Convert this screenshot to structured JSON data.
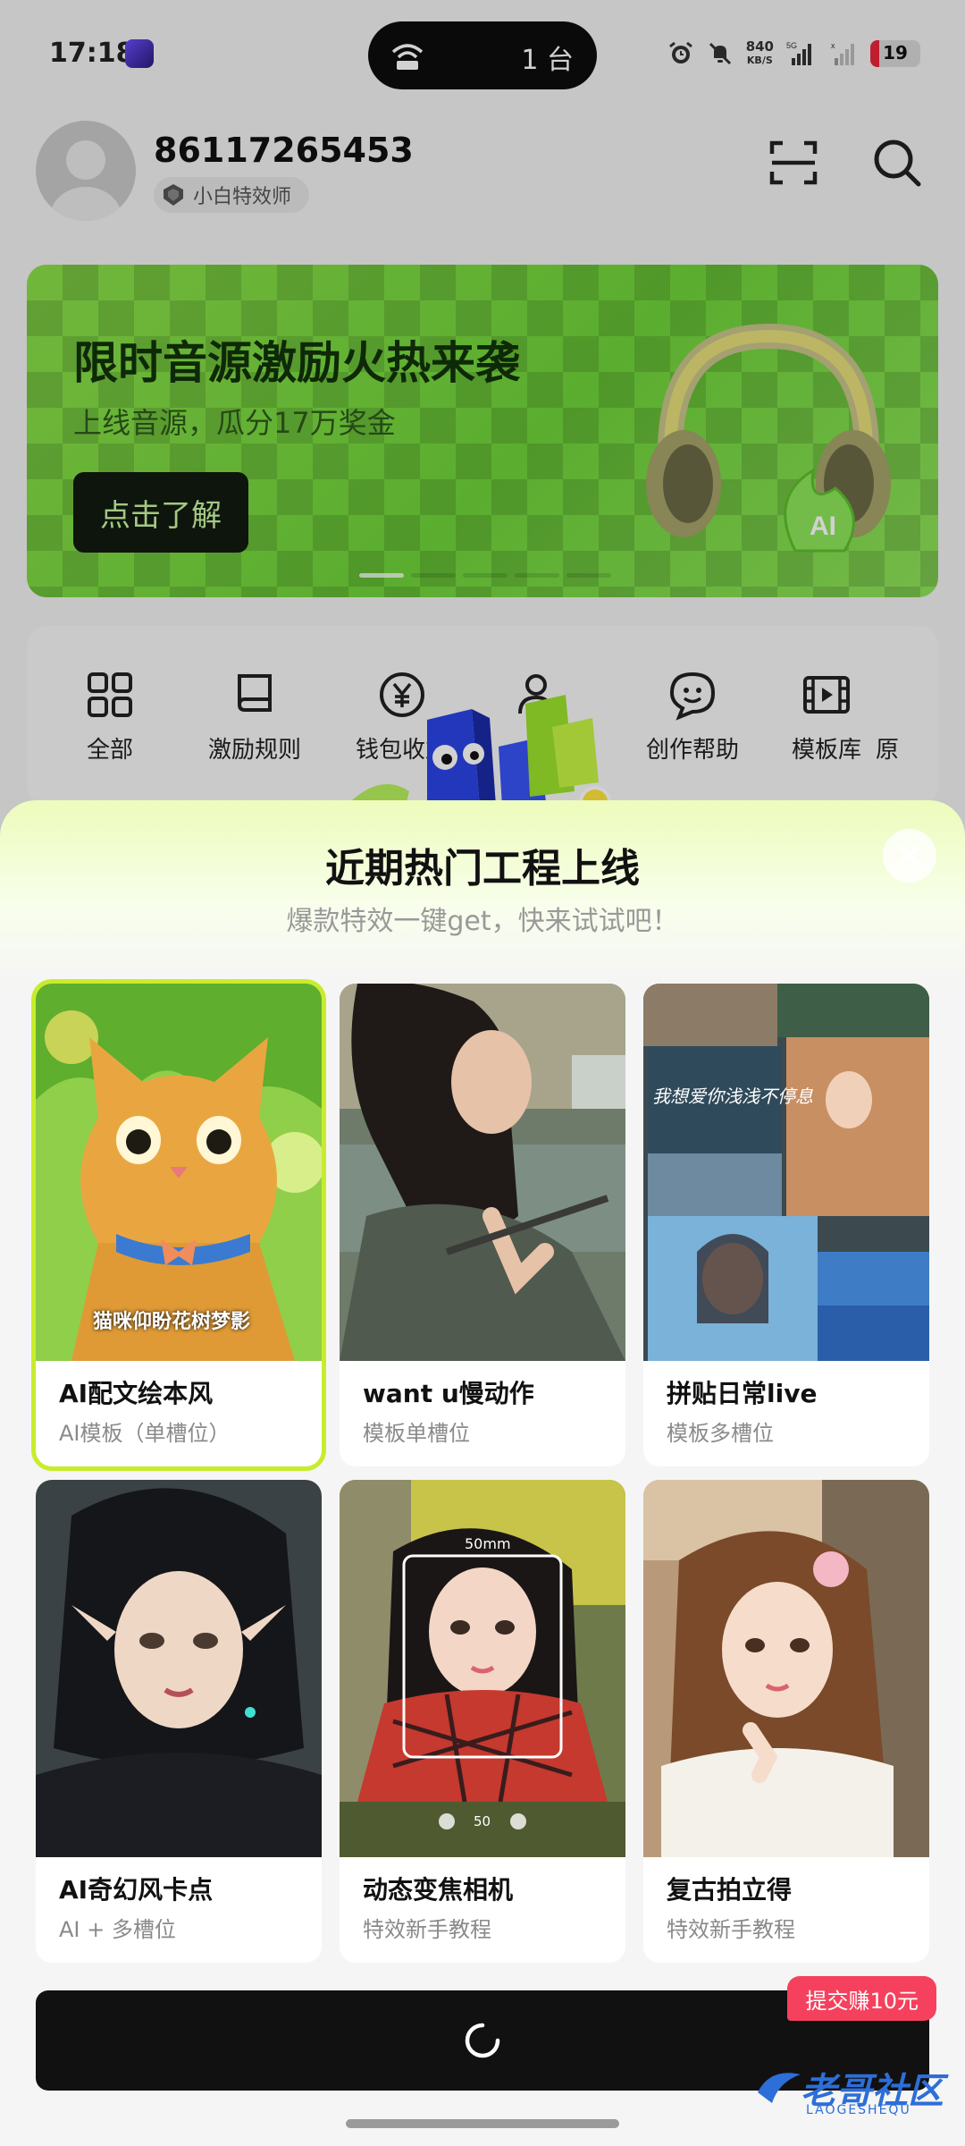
{
  "status_bar": {
    "time": "17:18",
    "hotspot_count": "1 台",
    "net_speed_value": "840",
    "net_speed_unit": "KB/S",
    "battery_level": "19"
  },
  "header": {
    "username": "86117265453",
    "badge_label": "小白特效师"
  },
  "banner": {
    "title": "限时音源激励火热来袭",
    "subtitle": "上线音源，瓜分17万奖金",
    "cta_label": "点击了解",
    "page_index": 0,
    "page_count": 5
  },
  "quick_nav": {
    "items": [
      {
        "label": "全部",
        "icon": "grid-icon"
      },
      {
        "label": "激励规则",
        "icon": "book-icon"
      },
      {
        "label": "钱包收益",
        "icon": "yuan-coin-icon"
      },
      {
        "label": "",
        "icon": "user-star-icon"
      },
      {
        "label": "创作帮助",
        "icon": "help-chat-icon"
      },
      {
        "label": "模板库",
        "icon": "film-icon"
      },
      {
        "label": "原",
        "icon": ""
      }
    ]
  },
  "sheet": {
    "title": "近期热门工程上线",
    "subtitle": "爆款特效一键get，快来试试吧！",
    "cards": [
      {
        "title": "AI配文绘本风",
        "subtitle": "AI模板（单槽位）",
        "overlay_text": "猫咪仰盼花树梦影",
        "selected": true
      },
      {
        "title": "want u慢动作",
        "subtitle": "模板单槽位",
        "overlay_text": "",
        "selected": false
      },
      {
        "title": "拼贴日常live",
        "subtitle": "模板多槽位",
        "overlay_text": "我想爱你浅浅不停息",
        "selected": false
      },
      {
        "title": "AI奇幻风卡点",
        "subtitle": "AI + 多槽位",
        "overlay_text": "",
        "selected": false
      },
      {
        "title": "动态变焦相机",
        "subtitle": "特效新手教程",
        "overlay_text": "50mm",
        "overlay_text_2": "50",
        "selected": false
      },
      {
        "title": "复古拍立得",
        "subtitle": "特效新手教程",
        "overlay_text": "",
        "selected": false
      }
    ],
    "earn_tag": "提交赚10元",
    "submit_button_state": "loading"
  },
  "watermark": {
    "text": "老哥社区",
    "small": "LAOGESHEQU"
  },
  "colors": {
    "accent_green": "#c8ec2d",
    "banner_green": "#6fd43a",
    "earn_red": "#f5415d"
  }
}
